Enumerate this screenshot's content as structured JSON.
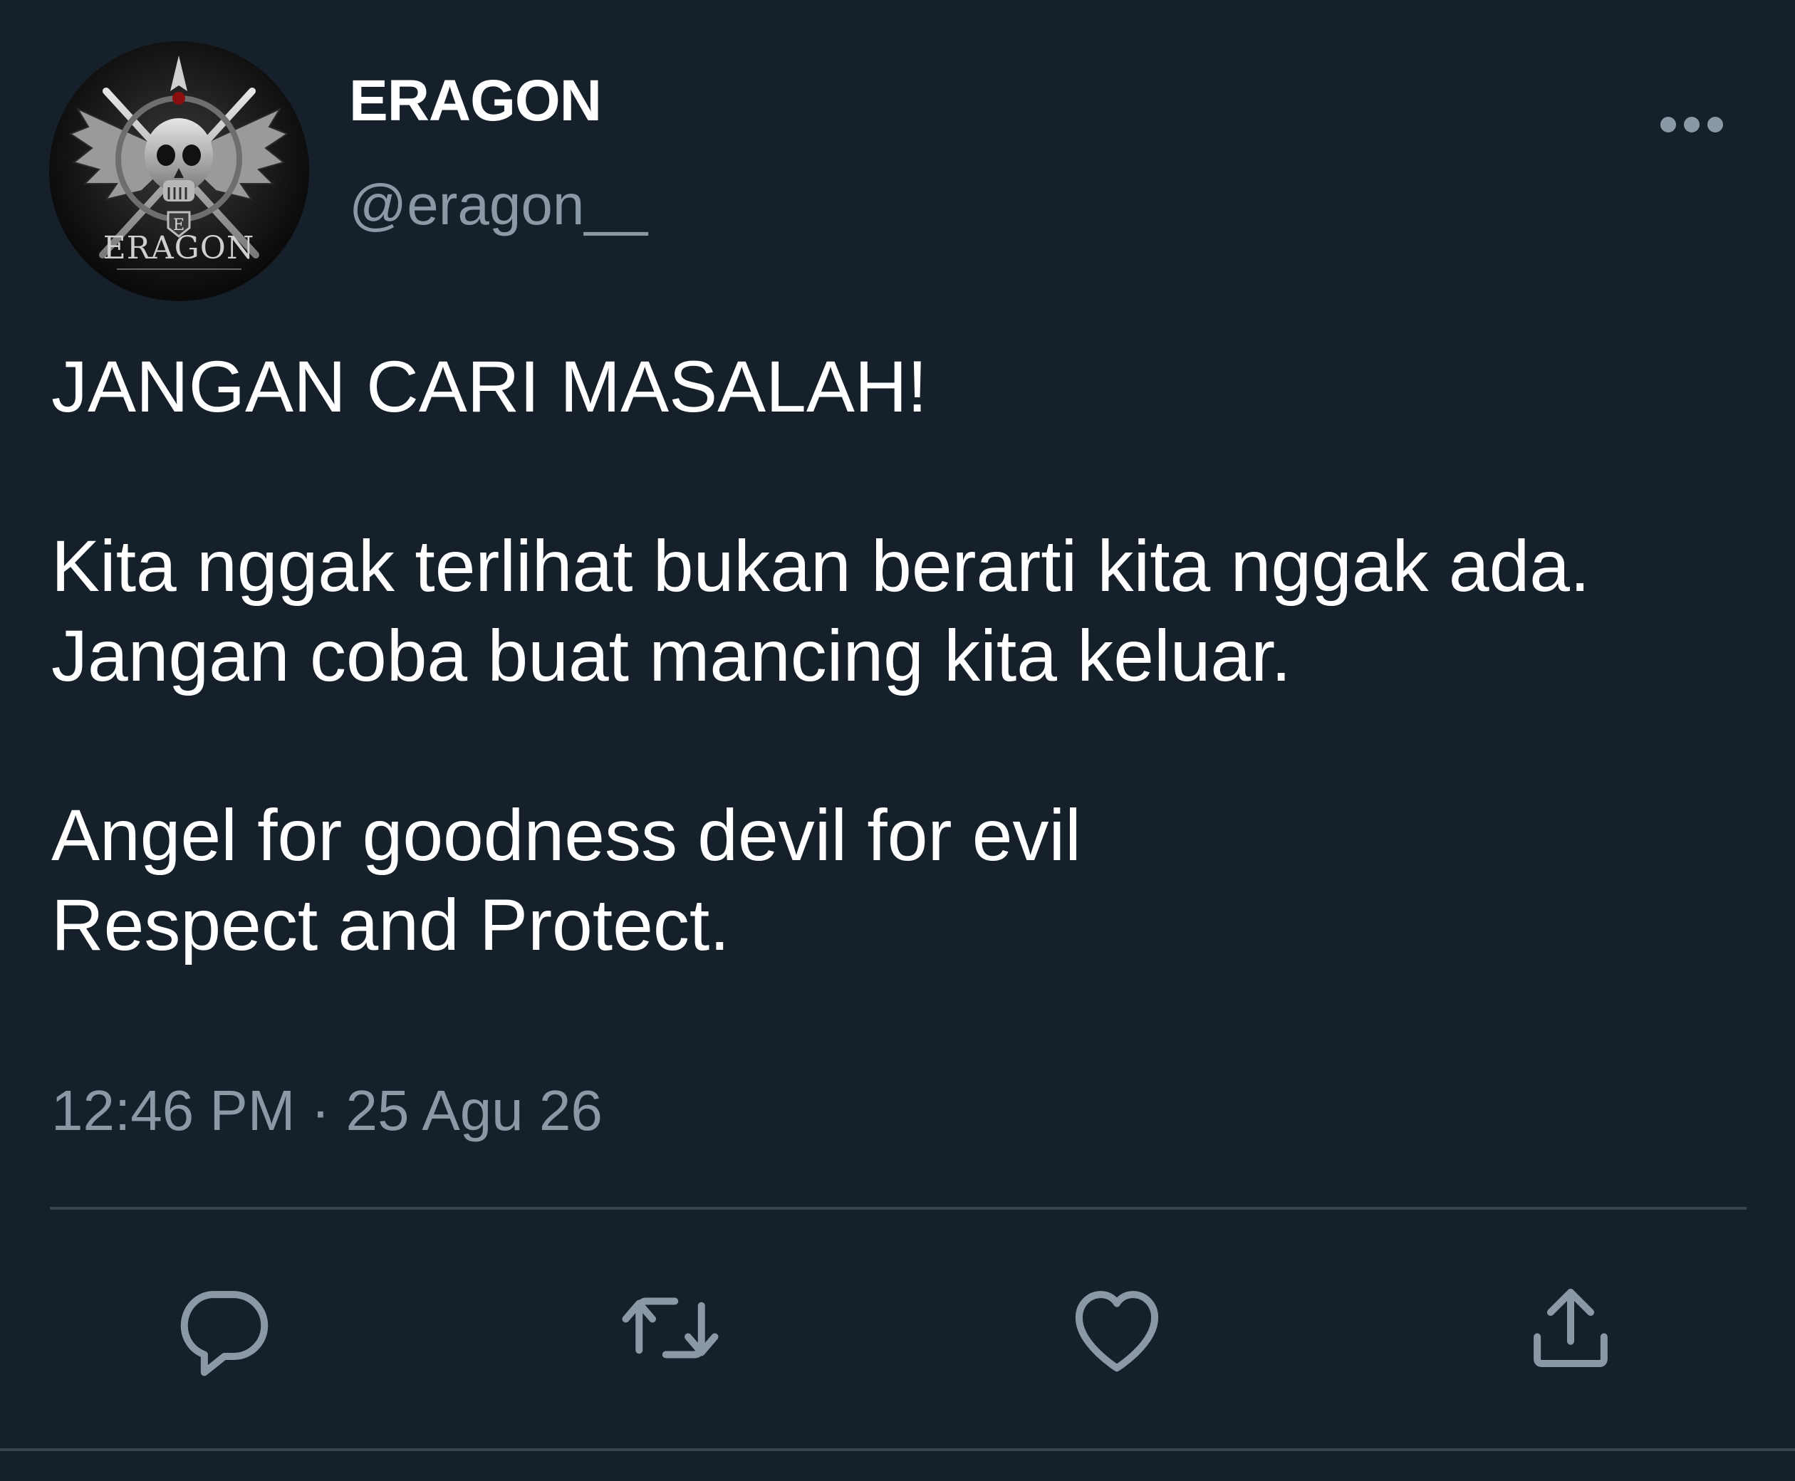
{
  "user": {
    "display_name": "ERAGON",
    "handle": "@eragon__",
    "avatar_text": "ERAGON"
  },
  "tweet": {
    "paragraphs": [
      "JANGAN CARI MASALAH!",
      "Kita nggak terlihat bukan berarti kita nggak ada.\nJangan coba buat mancing kita keluar.",
      "Angel for goodness devil for evil\nRespect and Protect."
    ],
    "time": "12:46 PM",
    "separator": "·",
    "date": "25 Agu 26"
  },
  "actions": [
    {
      "icon": "reply-icon"
    },
    {
      "icon": "retweet-icon"
    },
    {
      "icon": "heart-icon"
    },
    {
      "icon": "share-icon"
    }
  ],
  "colors": {
    "background": "#15202b",
    "text": "#ffffff",
    "secondary": "#8b98a5",
    "divider": "#38444d",
    "icon": "#8b98a5"
  }
}
